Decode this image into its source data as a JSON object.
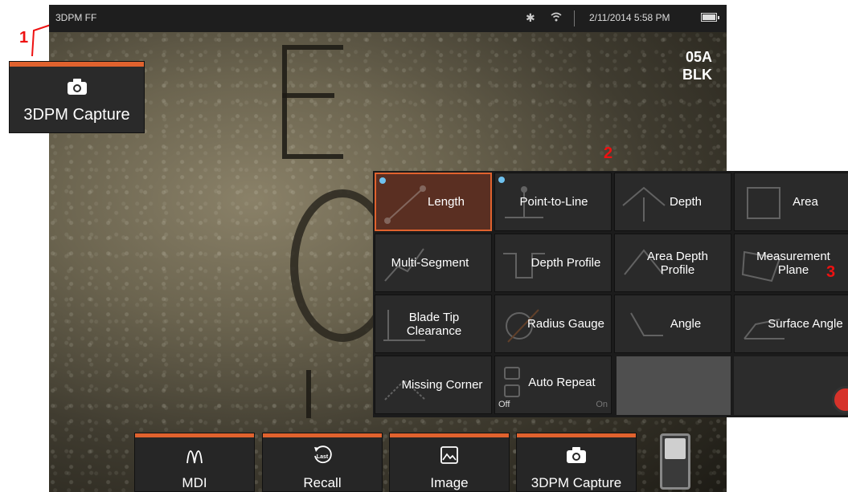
{
  "status_bar": {
    "title": "3DPM FF",
    "datetime": "2/11/2014 5:58 PM",
    "icons": [
      "bluetooth-icon",
      "wifi-icon",
      "battery-icon"
    ]
  },
  "image_tag": {
    "line1": "05A",
    "line2": "BLK"
  },
  "callouts": {
    "one": "1",
    "two": "2",
    "three": "3"
  },
  "side_capture": {
    "label": "3DPM Capture",
    "icon": "camera-icon"
  },
  "menu": {
    "tiles": [
      {
        "label": "Length",
        "icon": "length-icon",
        "active": true
      },
      {
        "label": "Point-to-Line",
        "icon": "point-to-line-icon"
      },
      {
        "label": "Depth",
        "icon": "depth-icon"
      },
      {
        "label": "Area",
        "icon": "area-icon"
      },
      {
        "label": "Multi-Segment",
        "icon": "multi-segment-icon"
      },
      {
        "label": "Depth Profile",
        "icon": "depth-profile-icon"
      },
      {
        "label": "Area Depth Profile",
        "icon": "area-depth-profile-icon"
      },
      {
        "label": "Measurement Plane",
        "icon": "measurement-plane-icon"
      },
      {
        "label": "Blade Tip Clearance",
        "icon": "blade-tip-icon"
      },
      {
        "label": "Radius Gauge",
        "icon": "radius-gauge-icon"
      },
      {
        "label": "Angle",
        "icon": "angle-icon"
      },
      {
        "label": "Surface Angle",
        "icon": "surface-angle-icon"
      },
      {
        "label": "Missing Corner",
        "icon": "missing-corner-icon"
      },
      {
        "label": "Auto Repeat",
        "icon": "auto-repeat-icon",
        "off_label": "Off",
        "on_label": "On"
      }
    ]
  },
  "bottom_bar": {
    "mdi": "MDI",
    "recall": "Recall",
    "recall_icon_text": "Last",
    "image": "Image",
    "capture": "3DPM Capture"
  },
  "colors": {
    "accent": "#e0622e",
    "active_tile": "#5a2f22",
    "dot": "#6fc2f0",
    "callout": "#ee1111"
  }
}
